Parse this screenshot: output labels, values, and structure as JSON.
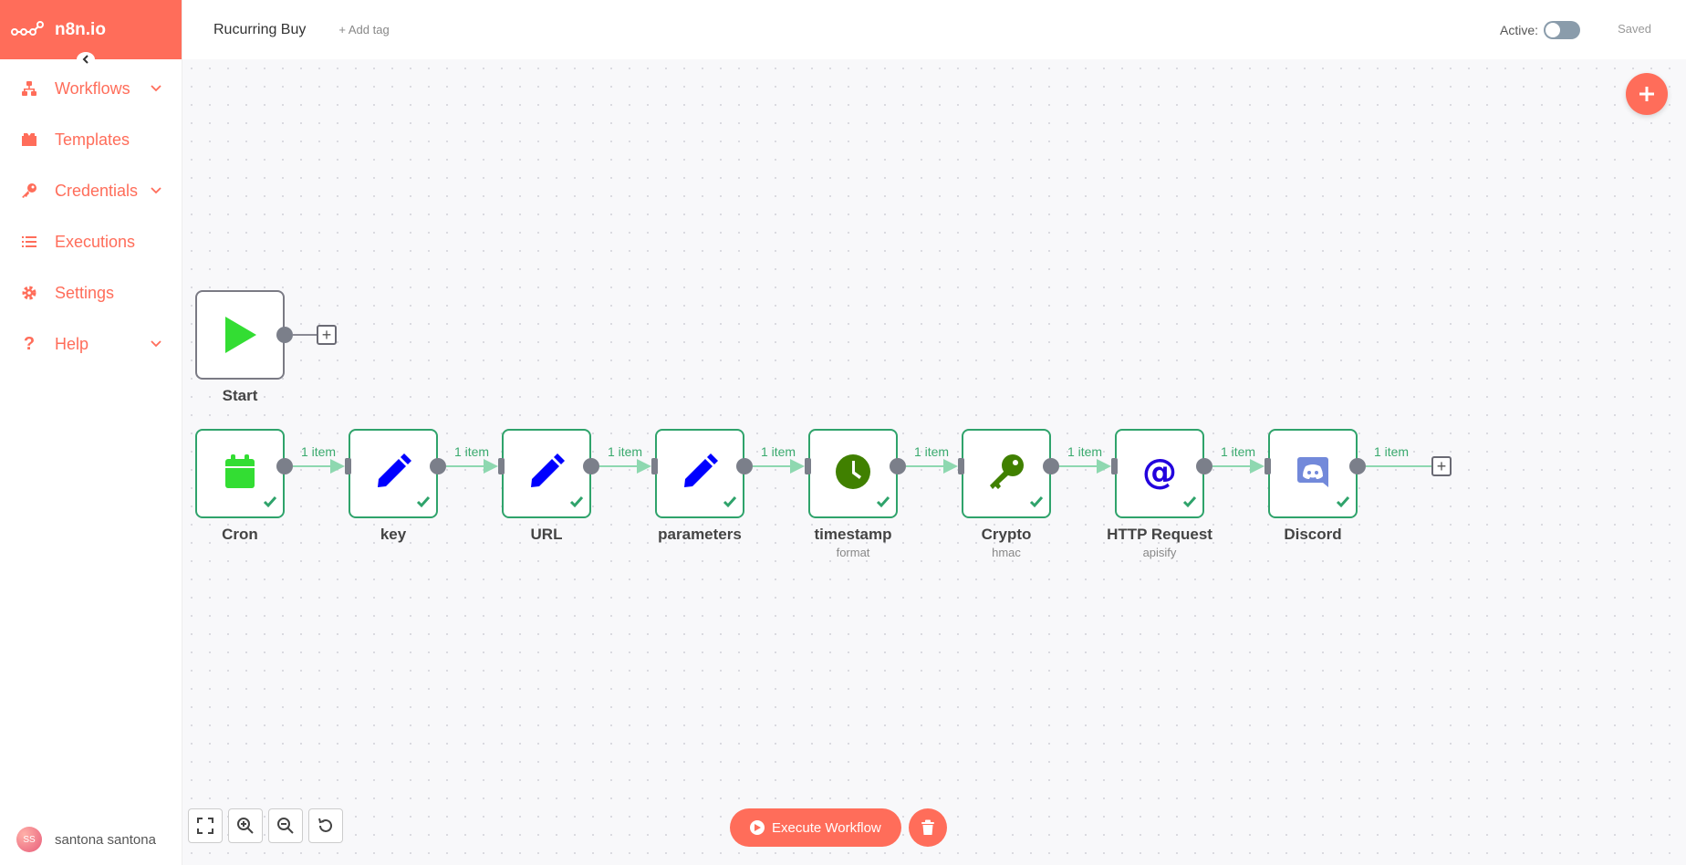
{
  "brand": {
    "name": "n8n.io"
  },
  "sidebar": {
    "items": [
      {
        "label": "Workflows",
        "icon": "workflows-icon",
        "has_chevron": true
      },
      {
        "label": "Templates",
        "icon": "templates-icon",
        "has_chevron": false
      },
      {
        "label": "Credentials",
        "icon": "key-icon",
        "has_chevron": true
      },
      {
        "label": "Executions",
        "icon": "list-icon",
        "has_chevron": false
      },
      {
        "label": "Settings",
        "icon": "gear-icon",
        "has_chevron": false
      },
      {
        "label": "Help",
        "icon": "question-icon",
        "has_chevron": true
      }
    ],
    "user": {
      "initials": "SS",
      "name": "santona santona"
    }
  },
  "header": {
    "workflow_name": "Rucurring Buy",
    "add_tag": "+ Add tag",
    "active_label": "Active:",
    "active": false,
    "saved_label": "Saved"
  },
  "nodes": {
    "start": {
      "label": "Start"
    },
    "chain": [
      {
        "label": "Cron",
        "subtitle": "",
        "icon": "calendar-icon",
        "color": "#33dd33"
      },
      {
        "label": "key",
        "subtitle": "",
        "icon": "pencil-icon",
        "color": "#0000ff"
      },
      {
        "label": "URL",
        "subtitle": "",
        "icon": "pencil-icon",
        "color": "#0000ff"
      },
      {
        "label": "parameters",
        "subtitle": "",
        "icon": "pencil-icon",
        "color": "#0000ff"
      },
      {
        "label": "timestamp",
        "subtitle": "format",
        "icon": "clock-icon",
        "color": "#408000"
      },
      {
        "label": "Crypto",
        "subtitle": "hmac",
        "icon": "key-icon",
        "color": "#408000"
      },
      {
        "label": "HTTP Request",
        "subtitle": "apisify",
        "icon": "at-sign-icon",
        "color": "#2200dd"
      },
      {
        "label": "Discord",
        "subtitle": "",
        "icon": "discord-icon",
        "color": "#7289da"
      }
    ],
    "connection_label": "1 item"
  },
  "footer": {
    "execute_label": "Execute Workflow"
  },
  "colors": {
    "accent": "#ff6d5a",
    "success": "#2fa36b"
  }
}
